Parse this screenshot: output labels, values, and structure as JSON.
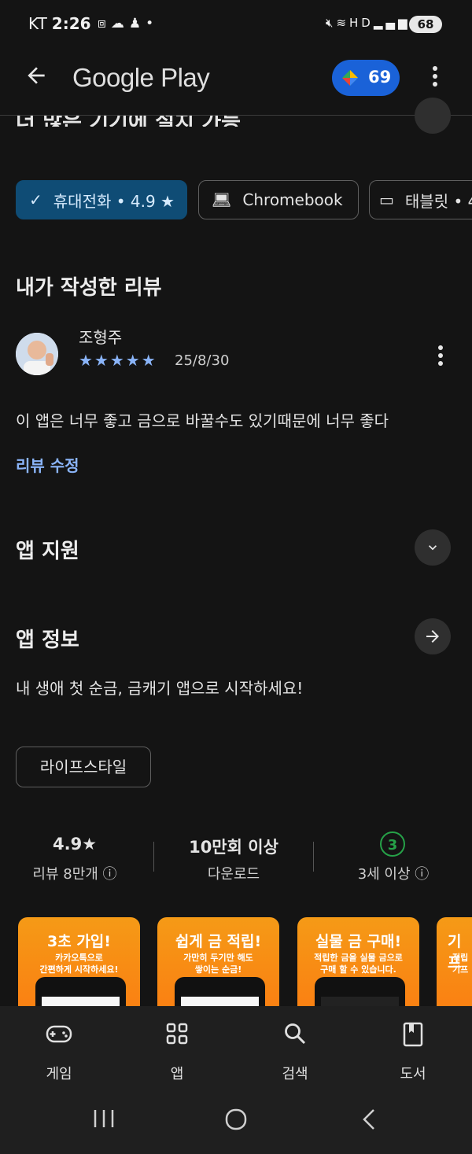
{
  "status_bar": {
    "carrier": "KT",
    "time": "2:26",
    "battery": "68"
  },
  "app_bar": {
    "title": "Google Play",
    "points": "69"
  },
  "partial_section_title": "더 많은 기기에 설치 가능",
  "device_chips": [
    {
      "label": "휴대전화 • 4.9 ★",
      "selected": true
    },
    {
      "label": "Chromebook",
      "selected": false
    },
    {
      "label": "태블릿 • 4",
      "selected": false
    }
  ],
  "my_review": {
    "heading": "내가 작성한 리뷰",
    "reviewer_name": "조형주",
    "stars": "★★★★★",
    "rating": 5,
    "date": "25/8/30",
    "text": "이 앱은 너무 좋고 금으로 바꿀수도 있기때문에 너무 좋다",
    "edit_link": "리뷰 수정"
  },
  "app_support": {
    "heading": "앱 지원"
  },
  "app_info": {
    "heading": "앱 정보",
    "description": "내 생애 첫 순금, 금캐기 앱으로 시작하세요!",
    "tag": "라이프스타일"
  },
  "stats": {
    "rating_value": "4.9★",
    "rating_label": "리뷰 8만개 ⓘ",
    "downloads_value": "10만회 이상",
    "downloads_label": "다운로드",
    "age_value": "3",
    "age_label": "3세 이상 ⓘ"
  },
  "screenshots": [
    {
      "title": "3초 가입!",
      "subtitle": "카카오톡으로\n간편하게 시작하세요!"
    },
    {
      "title": "쉽게 금 적립!",
      "subtitle": "가만히 두기만 해도\n쌓이는 순금!"
    },
    {
      "title": "실물 금 구매!",
      "subtitle": "적립한 금을 실물 금으로\n구매 할 수 있습니다."
    },
    {
      "title": "기프",
      "subtitle": "적립\n기프"
    }
  ],
  "bottom_nav": [
    {
      "label": "게임",
      "icon": "gamepad-icon"
    },
    {
      "label": "앱",
      "icon": "apps-grid-icon"
    },
    {
      "label": "검색",
      "icon": "search-icon"
    },
    {
      "label": "도서",
      "icon": "book-icon"
    }
  ],
  "colors": {
    "background": "#141414",
    "accent_blue": "#8ab4f8",
    "selected_chip": "#0f4c75",
    "points_badge": "#1a62d8",
    "age_green": "#26a148",
    "screenshot_orange": "#f59a16"
  }
}
